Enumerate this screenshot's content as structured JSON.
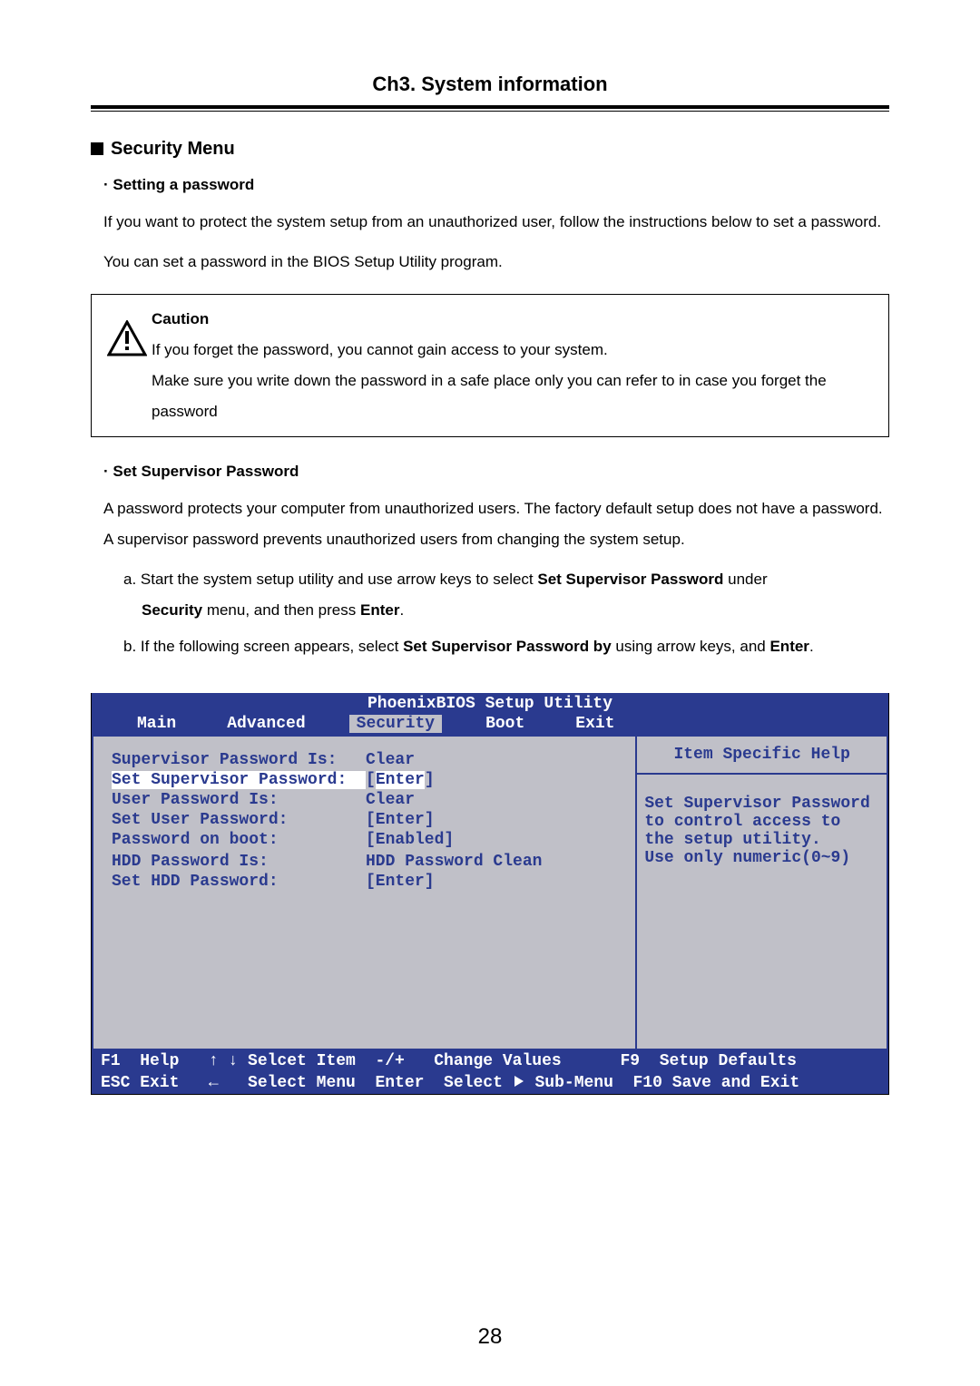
{
  "chapter": "Ch3. System information",
  "section": "Security Menu",
  "sub1_title": "· Setting a password",
  "sub1_p1": "If you want to protect the system setup from an unauthorized user, follow the instructions below  to set a password.",
  "sub1_p2": "You can set a password in the BIOS Setup Utility program.",
  "caution": {
    "title": "Caution",
    "l1": "If you forget the password, you cannot gain  access to your system.",
    "l2": "Make sure you write down the password in a safe place only you can refer to in case you forget the password"
  },
  "sub2_title": "· Set Supervisor Password",
  "sub2_p1": "A password protects your computer from unauthorized users. The factory default setup does not have a password. A supervisor password prevents unauthorized users from changing the system setup.",
  "step_a_pre": "a. Start the system setup utility and use arrow keys to select ",
  "step_a_bold1": "Set Supervisor Password",
  "step_a_mid": " under ",
  "step_a_bold2": "Security",
  "step_a_mid2": " menu, and then press ",
  "step_a_bold3": "Enter",
  "step_a_end": ".",
  "step_b_pre": "b. If the following screen appears, select ",
  "step_b_bold1": "Set Supervisor Password by",
  "step_b_mid": " using arrow keys, and ",
  "step_b_bold2": "Enter",
  "step_b_end": ".",
  "bios": {
    "title": "PhoenixBIOS Setup Utility",
    "tabs": [
      "Main",
      "Advanced",
      "Security",
      "Boot",
      "Exit"
    ],
    "active_tab": "Security",
    "rows": [
      {
        "label": "Supervisor Password Is:",
        "value": "Clear"
      },
      {
        "label": "Set Supervisor Password:",
        "value": "[Enter]",
        "highlight": true
      },
      {
        "label": "User Password Is:",
        "value": "Clear"
      },
      {
        "label": "Set User Password:",
        "value": "[Enter]"
      },
      {
        "label": "Password on boot:",
        "value": "[Enabled]"
      },
      {
        "label": "",
        "value": ""
      },
      {
        "label": "HDD Password Is:",
        "value": "HDD Password Clean"
      },
      {
        "label": "Set HDD Password:",
        "value": "[Enter]"
      }
    ],
    "help_title": "Item Specific Help",
    "help_l1": "Set Supervisor Password",
    "help_l2": "to control access to",
    "help_l3": "the setup utility.",
    "help_l4": "Use only numeric(0~9)",
    "hint1": "F1  Help   ↑ ↓ Selcet Item  -/+   Change Values      F9  Setup Defaults",
    "hint2a": "ESC Exit   ←   Select Menu  Enter  Select ",
    "hint2b": " Sub-Menu  F10 Save and Exit"
  },
  "page_number": "28"
}
